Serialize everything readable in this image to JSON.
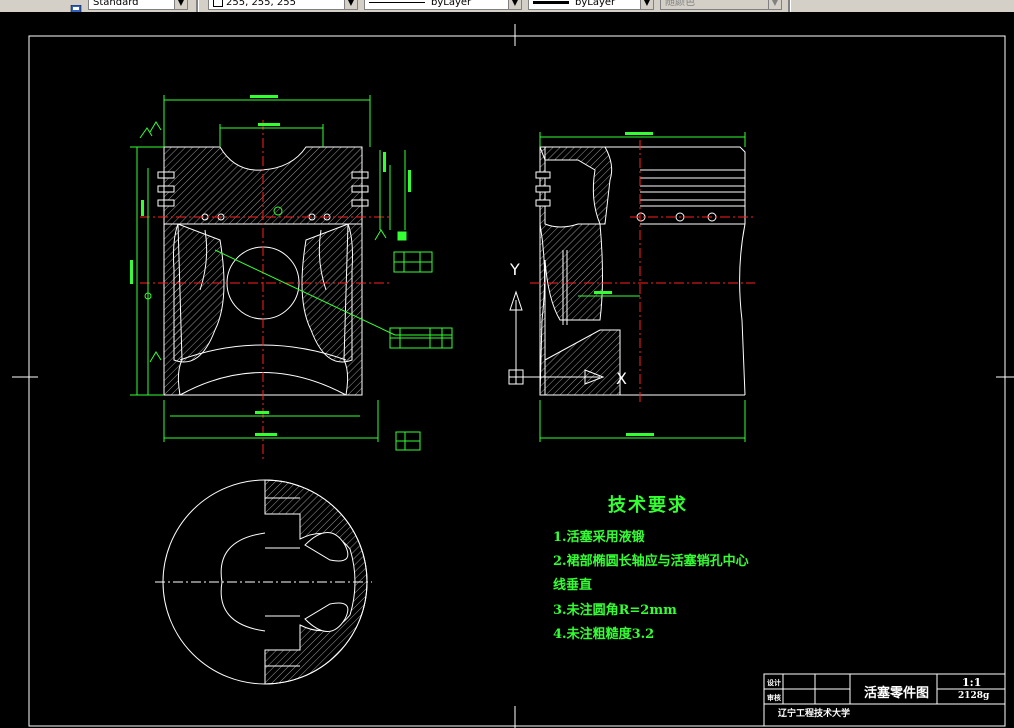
{
  "toolbar": {
    "text_style": "Standard",
    "color": "255, 255, 255",
    "linetype": "byLayer",
    "lineweight": "byLayer",
    "plot_style": "随颜色"
  },
  "tech_requirements": {
    "title": "技术要求",
    "items": [
      "1.活塞采用液锻",
      "2.裙部椭圆长轴应与活塞销孔中心",
      "线垂直",
      "3.未注圆角R=2mm",
      "4.未注粗糙度3.2"
    ]
  },
  "title_block": {
    "drawing_name": "活塞零件图",
    "scale": "1:1",
    "designer_label": "设计",
    "checker_label": "审核",
    "designer_value": "",
    "number": "2128g",
    "organization": "辽宁工程技术大学"
  },
  "ucs": {
    "x_label": "X",
    "y_label": "Y"
  },
  "colors": {
    "background": "#000000",
    "geometry": "#ffffff",
    "dimension": "#33ff33",
    "centerline": "#ff2020",
    "toolbar": "#d4d0c8"
  }
}
